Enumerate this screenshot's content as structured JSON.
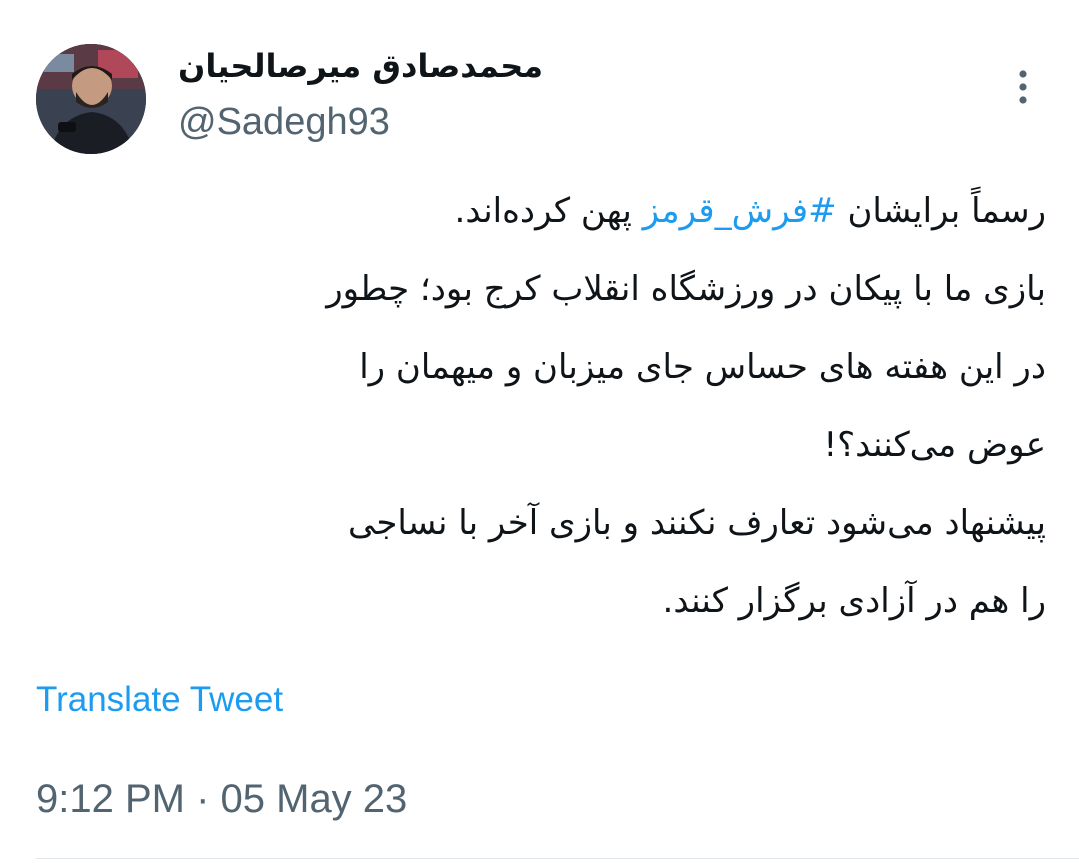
{
  "author": {
    "display_name": "محمدصادق میرصالحیان",
    "handle": "@Sadegh93"
  },
  "tweet": {
    "line1_prefix": "رسماً برایشان ",
    "hashtag": "#فرش_قرمز",
    "line1_suffix": " پهن کرده‌اند.",
    "line2": "بازی ما با پیکان در ورزشگاه انقلاب کرج بود؛ چطور",
    "line3": "در این هفته های حساس جای میزبان و میهمان را",
    "line4": "عوض می‌کنند؟!",
    "line5": "پیشنهاد می‌شود تعارف نکنند و بازی آخر با نساجی",
    "line6": "را هم در آزادی برگزار کنند."
  },
  "translate_label": "Translate Tweet",
  "timestamp": "9:12 PM · 05 May 23",
  "icons": {
    "more": "more-vertical-icon",
    "avatar": "avatar"
  },
  "colors": {
    "accent": "#1d9bf0",
    "text": "#0f1419",
    "secondary": "#536471"
  }
}
